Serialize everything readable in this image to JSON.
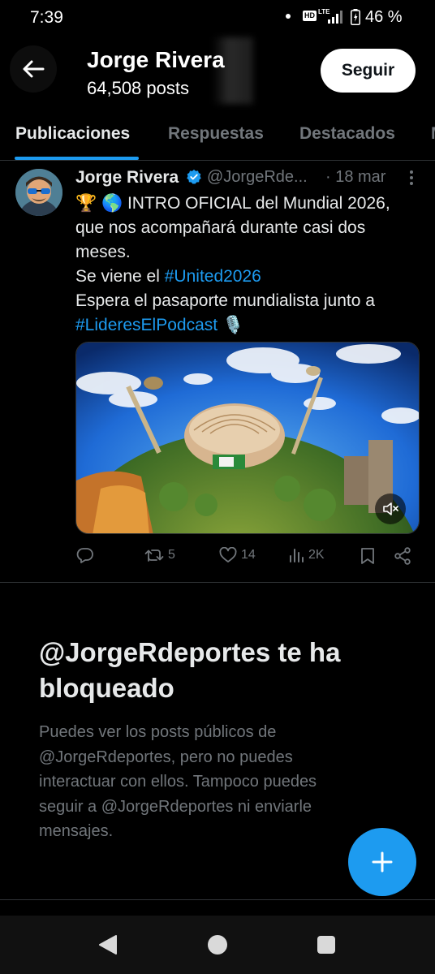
{
  "status_bar": {
    "time": "7:39",
    "network_badge": "HD",
    "network_type": "LTE",
    "battery_percent": "46 %"
  },
  "header": {
    "back_icon": "arrow-left-icon",
    "title": "Jorge Rivera",
    "subtitle": "64,508 posts",
    "follow_label": "Seguir"
  },
  "tabs": [
    {
      "label": "Publicaciones",
      "active": true
    },
    {
      "label": "Respuestas",
      "active": false
    },
    {
      "label": "Destacados",
      "active": false
    }
  ],
  "post": {
    "author_name": "Jorge Rivera",
    "handle": "@JorgeRde...",
    "date": "· 18 mar",
    "text": {
      "line1": "🏆 🌎 INTRO OFICIAL del Mundial 2026,",
      "line2": "que nos acompañará durante casi dos",
      "line3": "meses.",
      "line4_prefix": "Se viene el ",
      "hashtag1": "#United2026",
      "line5": "Espera el pasaporte mundialista junto a",
      "hashtag2": "#LideresElPodcast",
      "mic_emoji": "🎙️"
    },
    "actions": {
      "reply_count": "",
      "repost_count": "5",
      "like_count": "14",
      "views_count": "2K"
    }
  },
  "blocked_notice": {
    "title": "@JorgeRdeportes te ha bloqueado",
    "title_line1": "@JorgeRdeportes te ha",
    "title_line2": "bloqueado",
    "body_lines": [
      "Puedes ver los posts públicos de",
      "@JorgeRdeportes, pero no puedes",
      "interactuar con ellos. Tampoco puedes",
      "seguir a @JorgeRdeportes ni enviarle",
      "mensajes."
    ]
  },
  "colors": {
    "background": "#000000",
    "accent": "#1d9bf0",
    "text_primary": "#e7e9ea",
    "text_secondary": "#71767b",
    "divider": "#2f3336"
  }
}
